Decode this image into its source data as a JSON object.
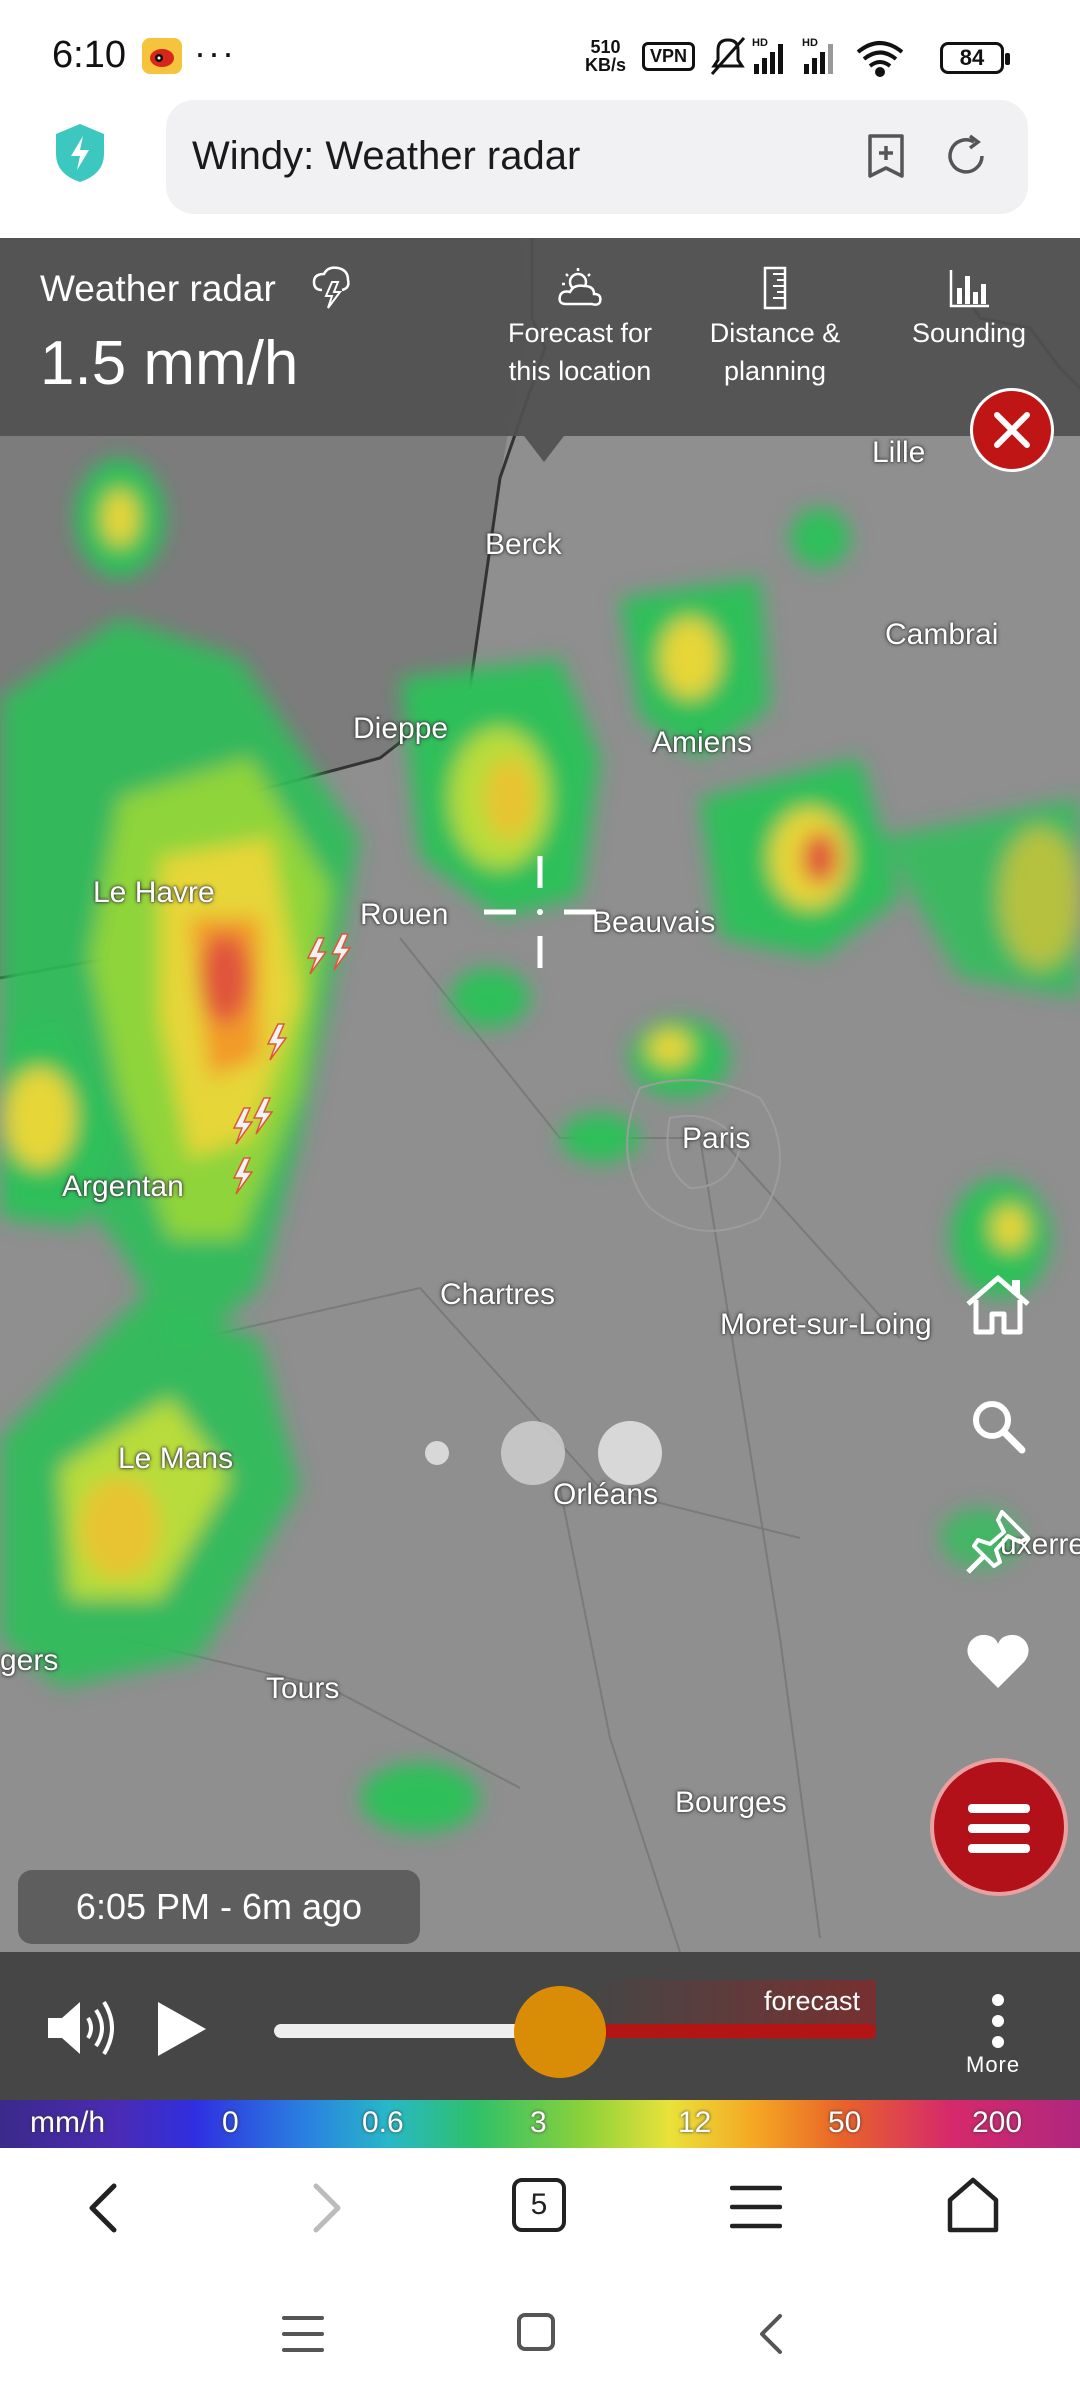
{
  "status_bar": {
    "time": "6:10",
    "more": "···",
    "net_speed_value": "510",
    "net_speed_unit": "KB/s",
    "vpn": "VPN",
    "battery": "84"
  },
  "browser": {
    "page_title": "Windy: Weather radar",
    "tab_count": "5"
  },
  "panel": {
    "title": "Weather radar",
    "value": "1.5 mm/h",
    "forecast_button": "Forecast for this location",
    "distance_button": "Distance & planning",
    "sounding_button": "Sounding"
  },
  "map": {
    "cities": {
      "lille": "Lille",
      "berck": "Berck",
      "cambrai": "Cambrai",
      "dieppe": "Dieppe",
      "amiens": "Amiens",
      "le_havre": "Le Havre",
      "rouen": "Rouen",
      "beauvais": "Beauvais",
      "paris": "Paris",
      "argentan": "Argentan",
      "chartres": "Chartres",
      "moret": "Moret-sur-Loing",
      "le_mans": "Le Mans",
      "orleans": "Orléans",
      "auxerre": "uxerre",
      "angers": "gers",
      "tours": "Tours",
      "bourges": "Bourges"
    },
    "timestamp": "6:05 PM - 6m ago"
  },
  "player": {
    "forecast_label": "forecast",
    "more_label": "More",
    "progress": 0.5
  },
  "legend": {
    "unit": "mm/h",
    "values": [
      "0",
      "0.6",
      "3",
      "12",
      "50",
      "200"
    ]
  },
  "colors": {
    "close_red": "#c01515",
    "menu_red": "#b3111a",
    "knob_orange": "#d98d06",
    "shield_teal": "#3cc8c0"
  }
}
